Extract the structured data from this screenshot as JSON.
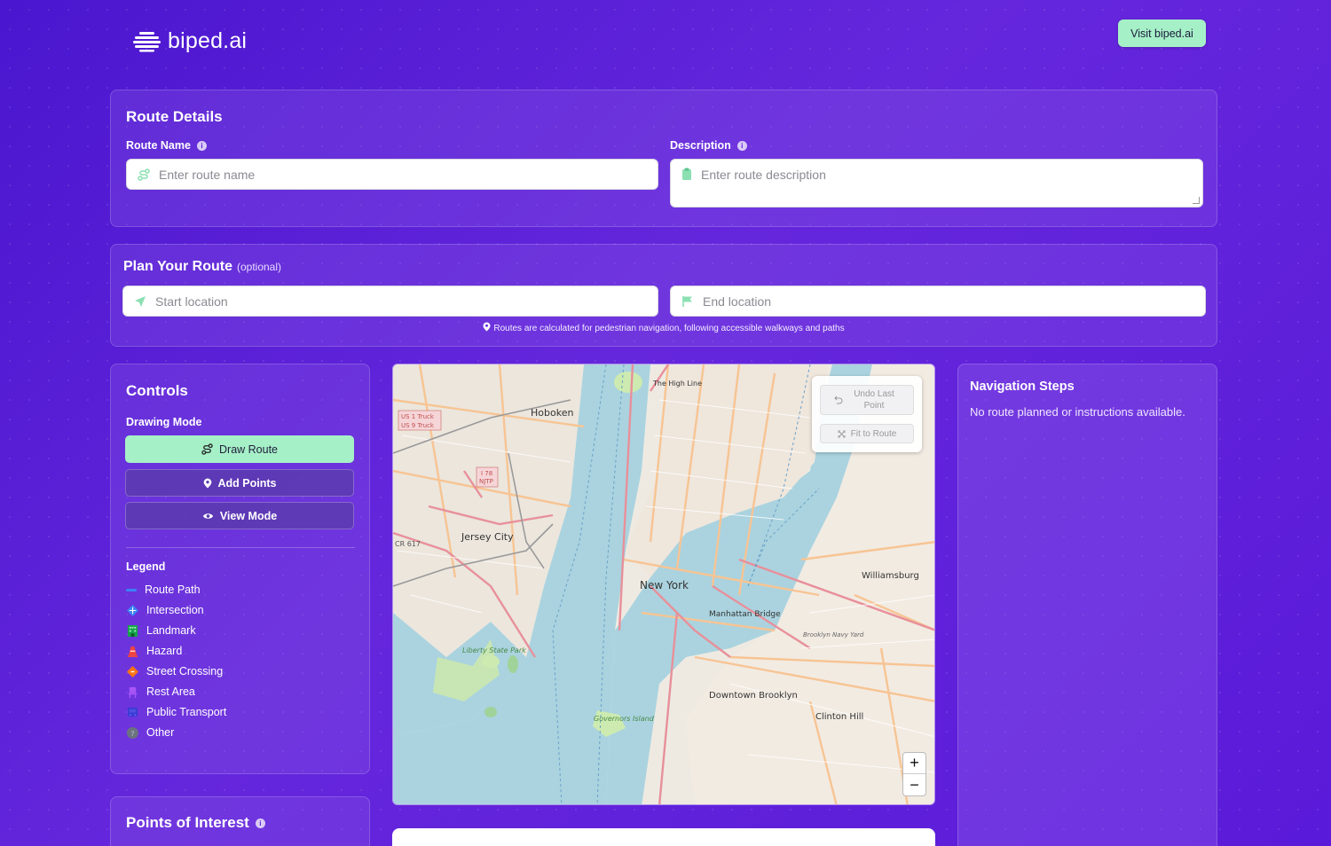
{
  "header": {
    "logo_text": "biped.ai",
    "visit_button": "Visit biped.ai"
  },
  "route_details": {
    "title": "Route Details",
    "route_name_label": "Route Name",
    "route_name_placeholder": "Enter route name",
    "description_label": "Description",
    "description_placeholder": "Enter route description"
  },
  "plan": {
    "title": "Plan Your Route",
    "optional": "(optional)",
    "start_placeholder": "Start location",
    "end_placeholder": "End location",
    "hint": "Routes are calculated for pedestrian navigation, following accessible walkways and paths"
  },
  "controls": {
    "title": "Controls",
    "drawing_mode_label": "Drawing Mode",
    "modes": [
      {
        "label": "Draw Route",
        "icon": "route-icon",
        "active": true
      },
      {
        "label": "Add Points",
        "icon": "pin-icon",
        "active": false
      },
      {
        "label": "View Mode",
        "icon": "eye-icon",
        "active": false
      }
    ],
    "legend_title": "Legend",
    "legend": [
      {
        "label": "Route Path",
        "icon": "line-icon",
        "color": "#3b82f6"
      },
      {
        "label": "Intersection",
        "icon": "diamond-icon",
        "color": "#3b82f6"
      },
      {
        "label": "Landmark",
        "icon": "building-icon",
        "color": "#16a34a"
      },
      {
        "label": "Hazard",
        "icon": "cone-icon",
        "color": "#ef4444"
      },
      {
        "label": "Street Crossing",
        "icon": "diamond-icon",
        "color": "#f97316"
      },
      {
        "label": "Rest Area",
        "icon": "chair-icon",
        "color": "#a855f7"
      },
      {
        "label": "Public Transport",
        "icon": "bus-icon",
        "color": "#3b3bd6"
      },
      {
        "label": "Other",
        "icon": "question-icon",
        "color": "#6b7280"
      }
    ]
  },
  "poi": {
    "title": "Points of Interest"
  },
  "map": {
    "undo_label": "Undo Last Point",
    "fit_label": "Fit to Route",
    "zoom_in": "+",
    "zoom_out": "−",
    "labels": {
      "hoboken": "Hoboken",
      "jersey_city": "Jersey City",
      "new_york": "New York",
      "williamsburg": "Williamsburg",
      "manhattan_bridge": "Manhattan Bridge",
      "downtown_brooklyn": "Downtown Brooklyn",
      "clinton_hill": "Clinton Hill",
      "high_line": "The High Line",
      "us_truck_1": "US 1 Truck",
      "us_truck_9": "US 9 Truck",
      "i78": "I 78",
      "njtp": "NJTP",
      "cr617": "CR 617",
      "liberty": "Liberty State Park",
      "governors": "Governors Island",
      "brooklyn_navy": "Brooklyn Navy Yard"
    }
  },
  "navigation": {
    "title": "Navigation Steps",
    "empty": "No route planned or instructions available."
  }
}
